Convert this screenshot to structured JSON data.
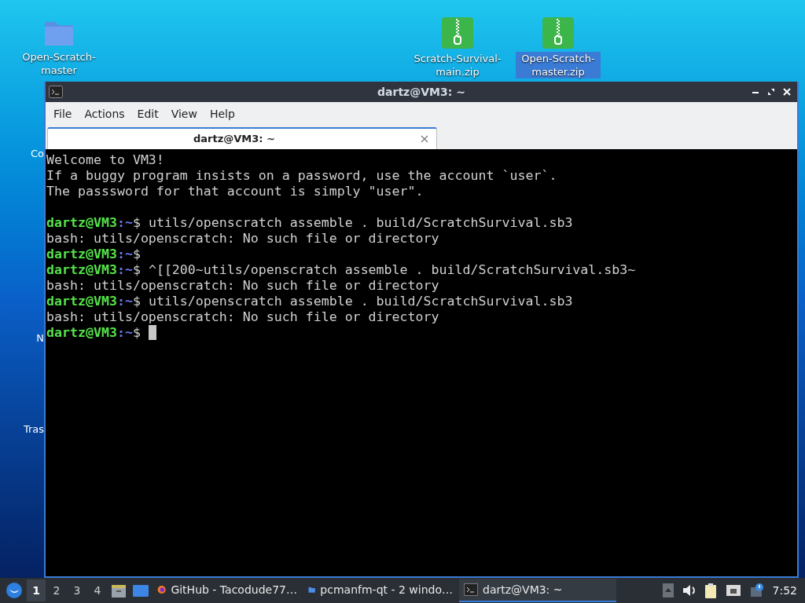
{
  "desktop_icons": [
    {
      "kind": "folder",
      "label": "Open-Scratch-master",
      "selected": false
    },
    {
      "kind": "zip",
      "label": "Scratch-Survival-main.zip",
      "selected": false
    },
    {
      "kind": "zip",
      "label": "Open-Scratch-master.zip",
      "selected": true
    }
  ],
  "hidden_icon_labels": [
    "Co",
    "N",
    "Tras"
  ],
  "window": {
    "title": "dartz@VM3: ~",
    "menu": [
      "File",
      "Actions",
      "Edit",
      "View",
      "Help"
    ],
    "tabs": [
      {
        "label": "dartz@VM3: ~",
        "selected": true
      }
    ],
    "terminal": {
      "cursor": true,
      "lines": [
        {
          "kind": "text",
          "text": "Welcome to VM3!"
        },
        {
          "kind": "text",
          "text": "If a buggy program insists on a password, use the account `user`."
        },
        {
          "kind": "text",
          "text": "The passsword for that account is simply \"user\"."
        },
        {
          "kind": "blank"
        },
        {
          "kind": "prompt",
          "user": "dartz@VM3",
          "path": ":~",
          "symbol": "$",
          "command": " utils/openscratch assemble . build/ScratchSurvival.sb3"
        },
        {
          "kind": "text",
          "text": "bash: utils/openscratch: No such file or directory"
        },
        {
          "kind": "prompt",
          "user": "dartz@VM3",
          "path": ":~",
          "symbol": "$"
        },
        {
          "kind": "prompt",
          "user": "dartz@VM3",
          "path": ":~",
          "symbol": "$",
          "command": " ^[[200~utils/openscratch assemble . build/ScratchSurvival.sb3~"
        },
        {
          "kind": "text",
          "text": "bash: utils/openscratch: No such file or directory"
        },
        {
          "kind": "prompt",
          "user": "dartz@VM3",
          "path": ":~",
          "symbol": "$",
          "command": " utils/openscratch assemble . build/ScratchSurvival.sb3"
        },
        {
          "kind": "text",
          "text": "bash: utils/openscratch: No such file or directory"
        },
        {
          "kind": "prompt",
          "user": "dartz@VM3",
          "path": ":~",
          "symbol": "$"
        }
      ]
    }
  },
  "taskbar": {
    "workspaces": [
      {
        "label": "1",
        "selected": true
      },
      {
        "label": "2",
        "selected": false
      },
      {
        "label": "3",
        "selected": false
      },
      {
        "label": "4",
        "selected": false
      }
    ],
    "tasks": [
      {
        "kind": "browser",
        "label": "GitHub - Tacodude77…",
        "selected": false
      },
      {
        "kind": "folder",
        "label": "pcmanfm-qt - 2 windo…",
        "selected": false
      },
      {
        "kind": "terminal",
        "label": "dartz@VM3: ~",
        "selected": true
      }
    ],
    "clock": "7:52"
  }
}
